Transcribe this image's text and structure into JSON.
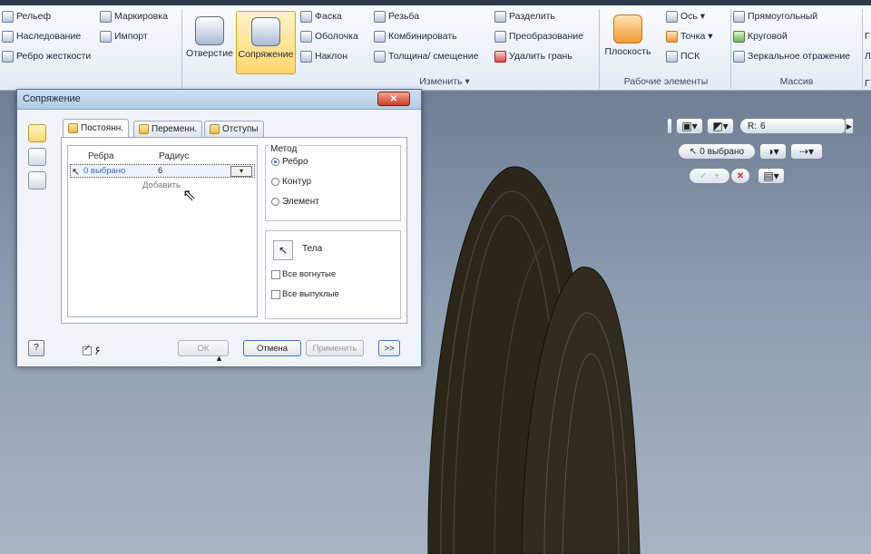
{
  "ribbon": {
    "col1": [
      "Рельеф",
      "Наследование",
      "Ребро жесткости"
    ],
    "col2": [
      "Маркировка",
      "Импорт"
    ],
    "hole_label": "Отверстие",
    "fillet_label": "Сопряжение",
    "col4": [
      "Фаска",
      "Оболочка",
      "Наклон"
    ],
    "col5": [
      "Резьба",
      "Комбинировать",
      "Толщина/ смещение"
    ],
    "col6": [
      "Разделить",
      "Преобразование",
      "Удалить грань"
    ],
    "modify_group_label": "Изменить ▾",
    "plane_label": "Плоскость",
    "col8": [
      "Ось ▾",
      "Точка ▾",
      "ПСК"
    ],
    "work_features_label": "Рабочие элементы",
    "col9": [
      "Прямоугольный",
      "Круговой",
      "Зеркальное отражение"
    ],
    "pattern_label": "Массив",
    "edge_labels": [
      "Г",
      "Л",
      "Г"
    ]
  },
  "mini_toolbar": {
    "radius_prefix": "R:",
    "radius_value": "6",
    "selection_label": "0 выбрано",
    "ok_glyph": "✓",
    "plus_glyph": "+",
    "cancel_glyph": "✕"
  },
  "dialog": {
    "title": "Сопряжение",
    "close_glyph": "✕",
    "tabs": [
      "Постоянн.",
      "Переменн.",
      "Отступы"
    ],
    "edges_header": "Ребра",
    "radius_header": "Радиус",
    "row_count": "0 выбрано",
    "row_radius": "6",
    "add_label": "Добавить",
    "method_title": "Метод",
    "methods": [
      "Ребро",
      "Контур",
      "Элемент"
    ],
    "bodies_label": "Тела",
    "all_concave": "Все вогнутые",
    "all_convex": "Все выпуклые",
    "help_glyph": "?",
    "preview_glyph": "&#x6F6;",
    "ok": "ОК",
    "cancel": "Отмена",
    "apply": "Применить",
    "more": ">>",
    "collapse_glyph": "▲"
  },
  "colors": {
    "ribbon_bg": "#e9eef5",
    "model": "#2b2619",
    "dialog_bg": "#f0f3f8",
    "accent": "#3f78c8"
  }
}
